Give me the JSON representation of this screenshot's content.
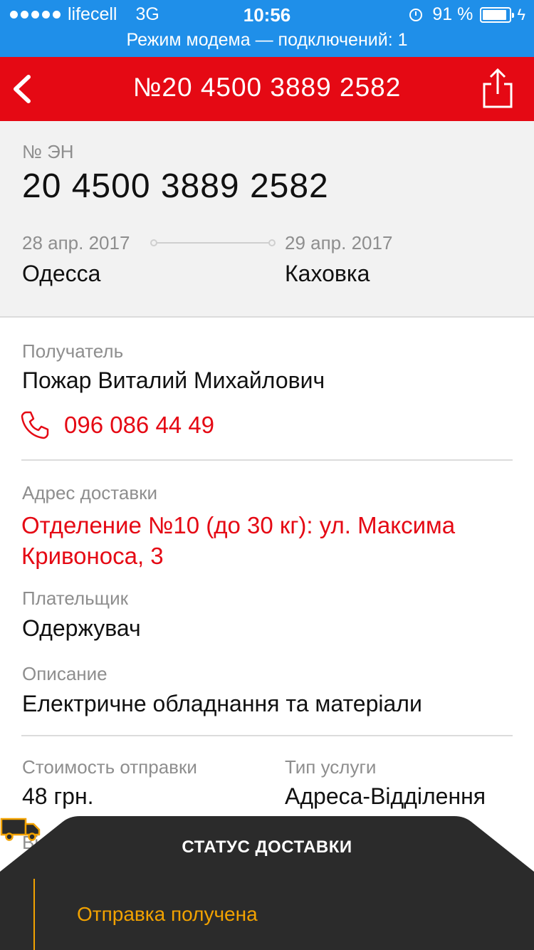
{
  "status_bar": {
    "carrier": "lifecell",
    "network": "3G",
    "time": "10:56",
    "battery": "91 %",
    "battery_level": 0.91,
    "hotspot": "Режим модема — подключений: 1"
  },
  "nav": {
    "title": "№20 4500 3889 2582",
    "back_icon": "chevron-left-icon",
    "share_icon": "share-icon"
  },
  "shipment": {
    "en_label": "№ ЭН",
    "en_number": "20 4500 3889 2582",
    "date_from": "28 апр. 2017",
    "date_to": "29 апр. 2017",
    "city_from": "Одесса",
    "city_to": "Каховка"
  },
  "recipient": {
    "label": "Получатель",
    "name": "Пожар Виталий Михайлович",
    "phone": "096 086 44 49"
  },
  "delivery": {
    "address_label": "Адрес доставки",
    "address": "Отделение №10 (до 30 кг): ул. Максима Кривоноса, 3",
    "payer_label": "Плательщик",
    "payer": "Одержувач",
    "description_label": "Описание",
    "description": "Електричне обладнання та матеріали"
  },
  "cost": {
    "cost_label": "Стоимость отправки",
    "cost_value": "48 грн.",
    "service_label": "Тип услуги",
    "service_value": "Адреса-Відділення",
    "next_label_partial": "Ві"
  },
  "status_sheet": {
    "title": "СТАТУС ДОСТАВКИ",
    "status": "Отправка получена"
  },
  "colors": {
    "status_bar": "#1f8fe9",
    "brand_red": "#e50914",
    "sheet_dark": "#2b2b2b",
    "status_orange": "#f2a200"
  }
}
